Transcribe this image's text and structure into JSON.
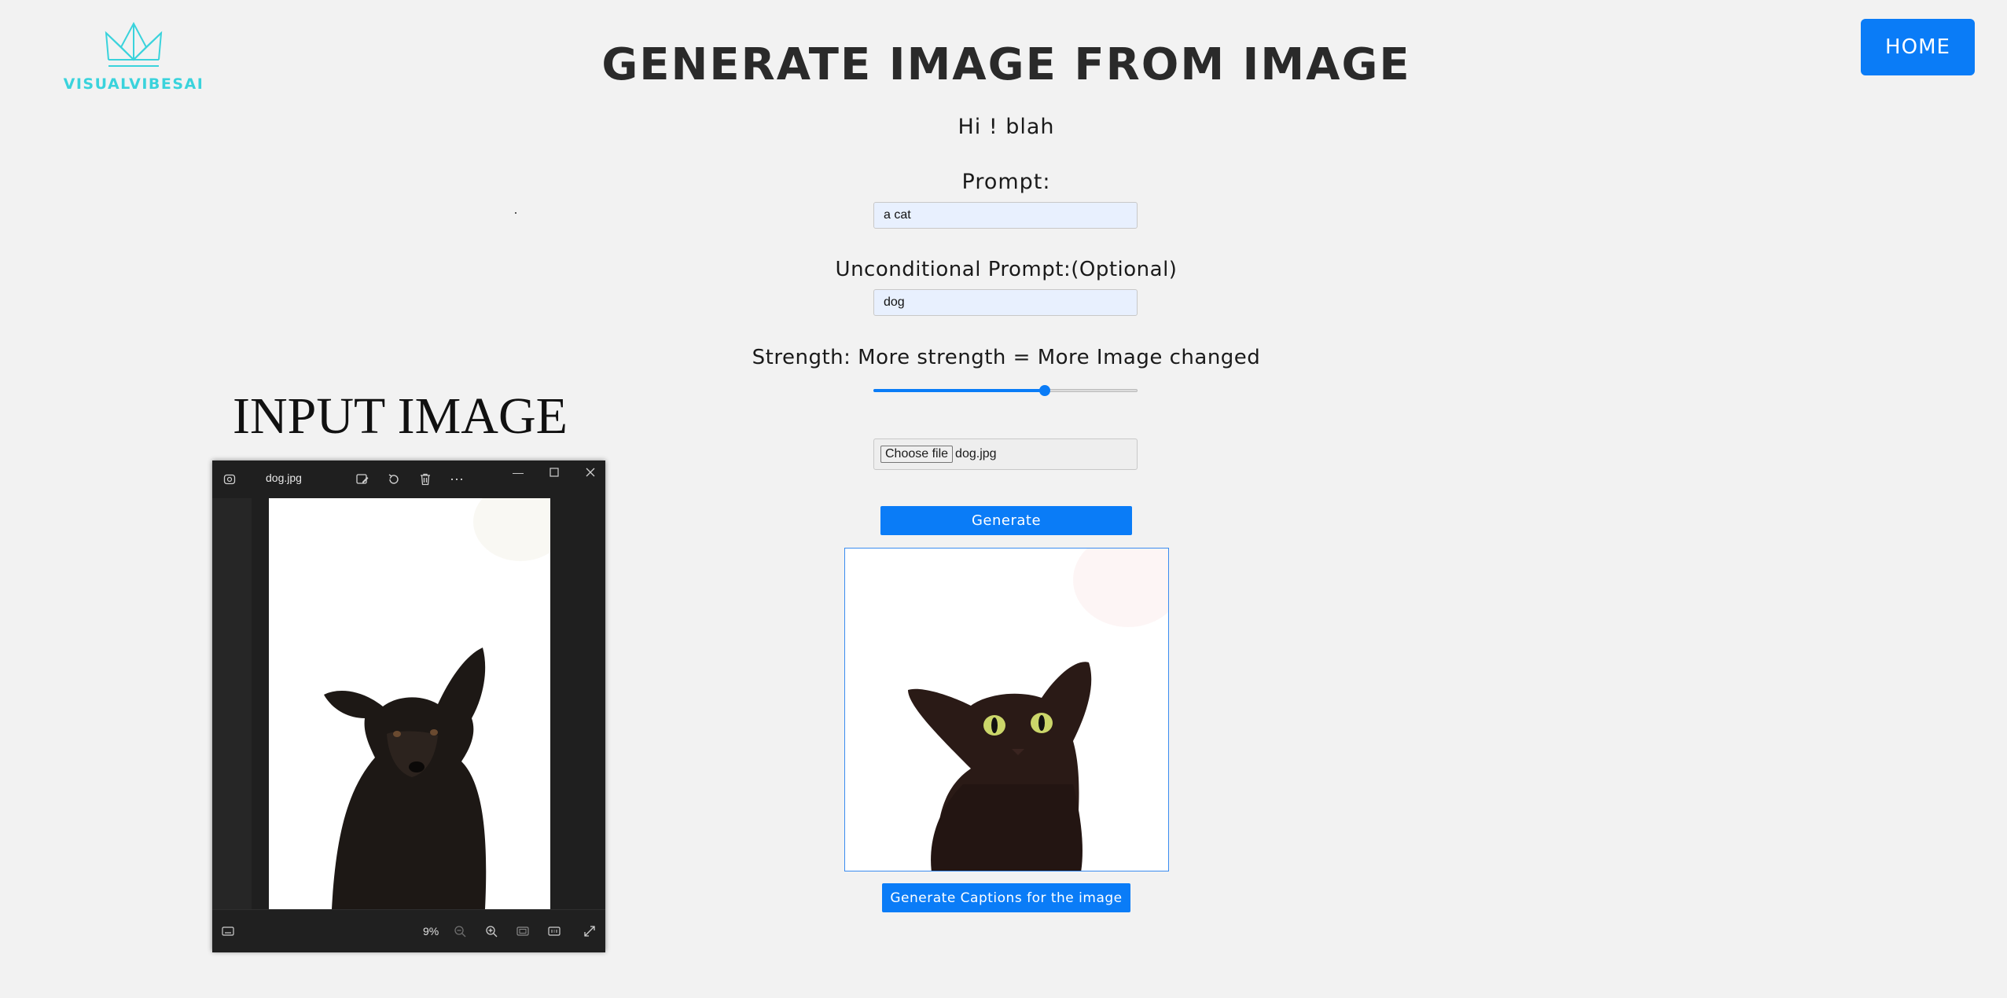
{
  "brand": {
    "name": "VISUALVIBESAI"
  },
  "nav": {
    "home_label": "HOME"
  },
  "page": {
    "title": "GENERATE IMAGE FROM IMAGE",
    "greeting": "Hi ! blah"
  },
  "form": {
    "prompt_label": "Prompt:",
    "prompt_value": "a cat",
    "uncond_label": "Unconditional Prompt:(Optional)",
    "uncond_value": "dog",
    "strength_label": "Strength: More strength = More Image changed",
    "strength_value": 0.65,
    "choose_file_label": "Choose file",
    "file_name": "dog.jpg",
    "generate_label": "Generate",
    "caption_label": "Generate Captions for the image"
  },
  "input_image": {
    "title": "INPUT IMAGE",
    "viewer": {
      "filename": "dog.jpg",
      "zoom": "9%"
    }
  },
  "colors": {
    "accent": "#0a7cf7",
    "brand": "#3ad3dc",
    "background": "#f2f2f2"
  }
}
